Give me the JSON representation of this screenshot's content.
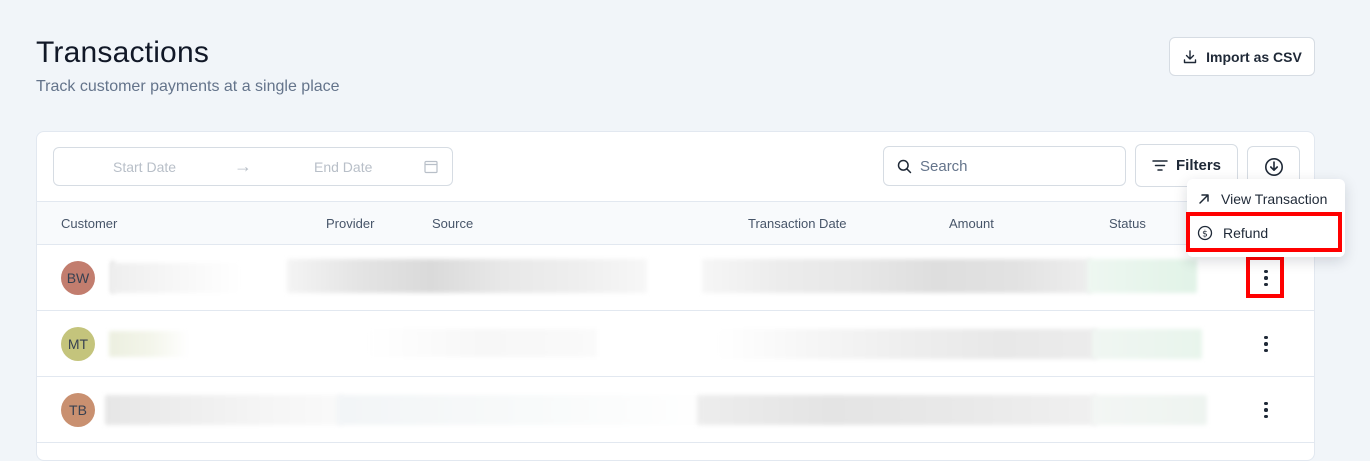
{
  "header": {
    "title": "Transactions",
    "subtitle": "Track customer payments at a single place",
    "import_label": "Import as CSV"
  },
  "toolbar": {
    "start_date_placeholder": "Start Date",
    "end_date_placeholder": "End Date",
    "search_placeholder": "Search",
    "filters_label": "Filters"
  },
  "table": {
    "columns": [
      "Customer",
      "Provider",
      "Source",
      "Transaction Date",
      "Amount",
      "Status"
    ],
    "rows": [
      {
        "initials": "BW",
        "avatar_color": "#c27d6e"
      },
      {
        "initials": "MT",
        "avatar_color": "#c4c47c"
      },
      {
        "initials": "TB",
        "avatar_color": "#c99070"
      }
    ]
  },
  "row_menu": {
    "items": [
      {
        "label": "View Transaction",
        "icon": "arrow-up-right-icon"
      },
      {
        "label": "Refund",
        "icon": "dollar-circle-icon"
      }
    ]
  },
  "colors": {
    "background": "#f1f5f9",
    "highlight": "#ff0000",
    "status_blur": "#e3f5e9"
  }
}
